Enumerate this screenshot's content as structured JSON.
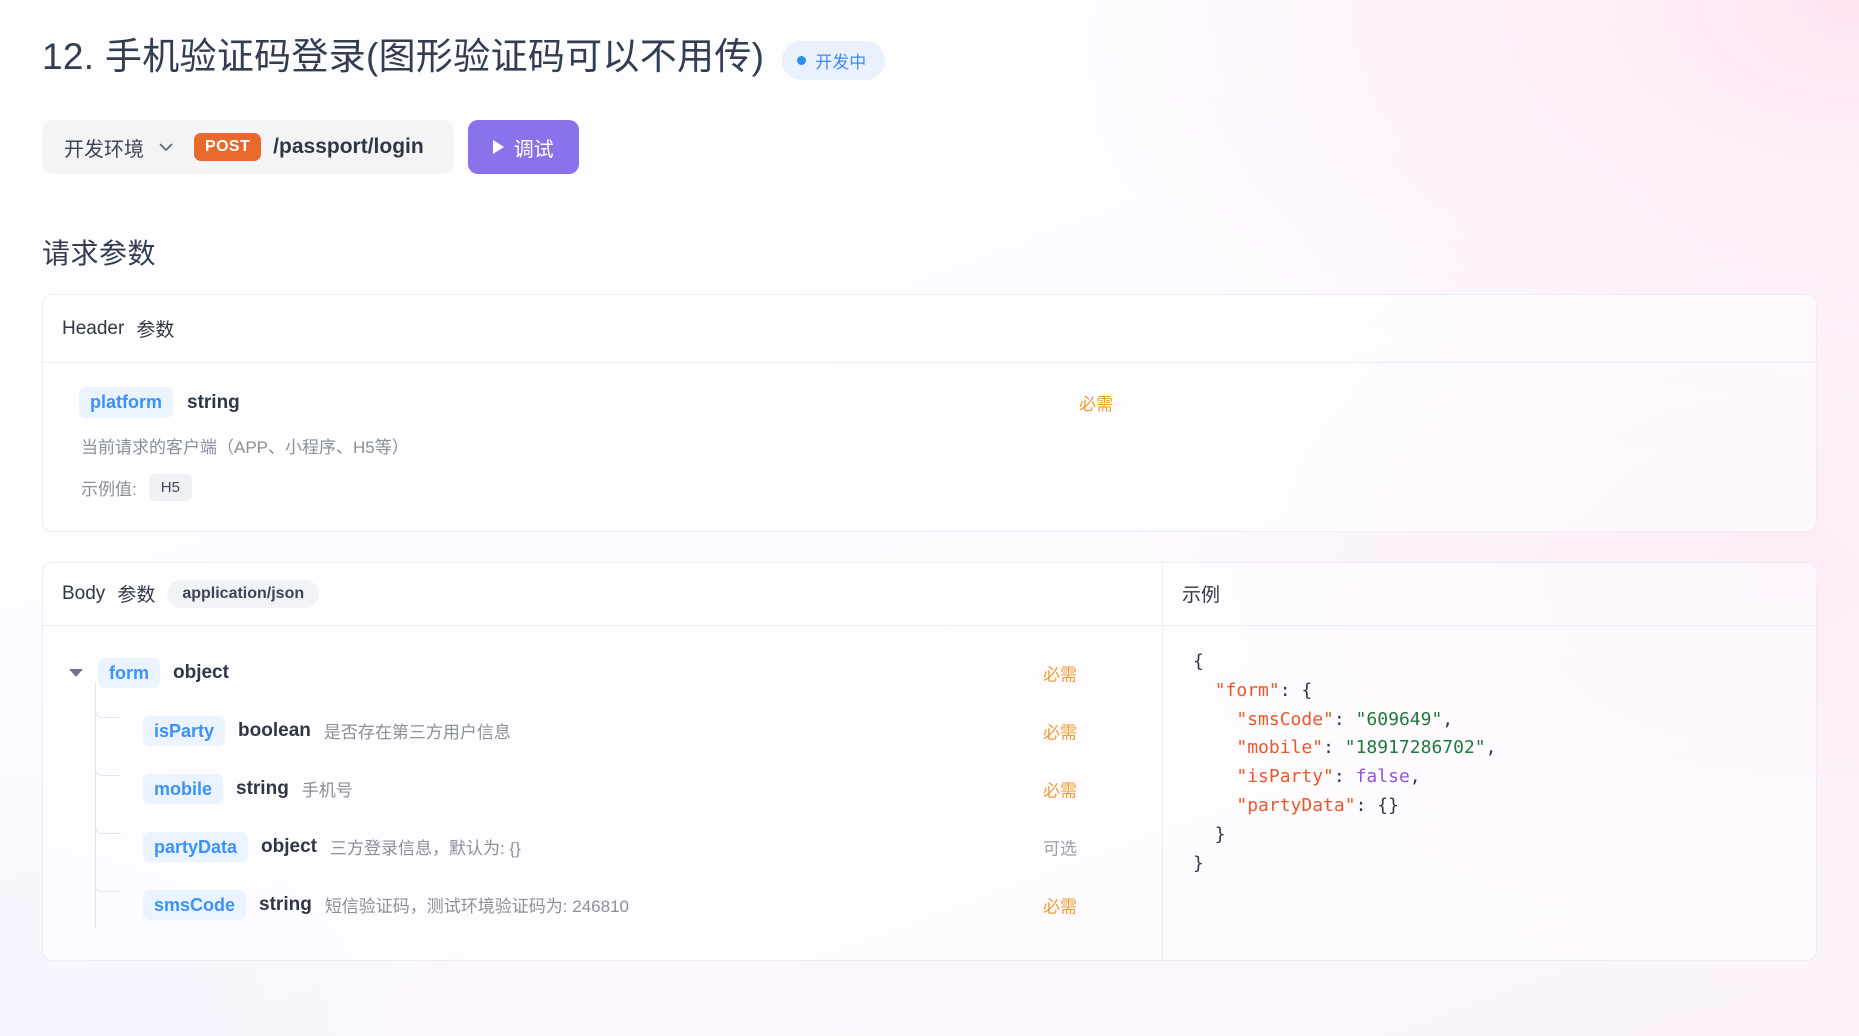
{
  "header": {
    "title": "12. 手机验证码登录(图形验证码可以不用传)",
    "status_badge": "开发中",
    "status_color": "#3d8bf2"
  },
  "toolbar": {
    "environment": "开发环境",
    "method": "POST",
    "method_color": "#e8692a",
    "path": "/passport/login",
    "debug_label": "调试",
    "debug_color": "#8b72ea"
  },
  "request_section": {
    "heading": "请求参数"
  },
  "header_params": {
    "card_title_main": "Header",
    "card_title_sub": "参数",
    "rows": [
      {
        "name": "platform",
        "type": "string",
        "description": "当前请求的客户端（APP、小程序、H5等）",
        "example_label": "示例值:",
        "example_value": "H5",
        "required_label": "必需",
        "required": true
      }
    ]
  },
  "body_params": {
    "card_title_main": "Body",
    "card_title_sub": "参数",
    "mime": "application/json",
    "example_title": "示例",
    "rows": [
      {
        "name": "form",
        "type": "object",
        "description": "",
        "required_label": "必需",
        "required": true,
        "level": 0
      },
      {
        "name": "isParty",
        "type": "boolean",
        "description": "是否存在第三方用户信息",
        "required_label": "必需",
        "required": true,
        "level": 1
      },
      {
        "name": "mobile",
        "type": "string",
        "description": "手机号",
        "required_label": "必需",
        "required": true,
        "level": 1
      },
      {
        "name": "partyData",
        "type": "object",
        "description": "三方登录信息，默认为: {}",
        "required_label": "可选",
        "required": false,
        "level": 1
      },
      {
        "name": "smsCode",
        "type": "string",
        "description": "短信验证码，测试环境验证码为: 246810",
        "required_label": "必需",
        "required": true,
        "level": 1
      }
    ],
    "example_json": {
      "l1": "{",
      "l2_key": "\"form\"",
      "l2_rest": ": {",
      "l3_key": "\"smsCode\"",
      "l3_val": "\"609649\"",
      "l4_key": "\"mobile\"",
      "l4_val": "\"18917286702\"",
      "l5_key": "\"isParty\"",
      "l5_val": "false",
      "l6_key": "\"partyData\"",
      "l6_val": "{}",
      "l7": "}",
      "l8": "}"
    }
  }
}
